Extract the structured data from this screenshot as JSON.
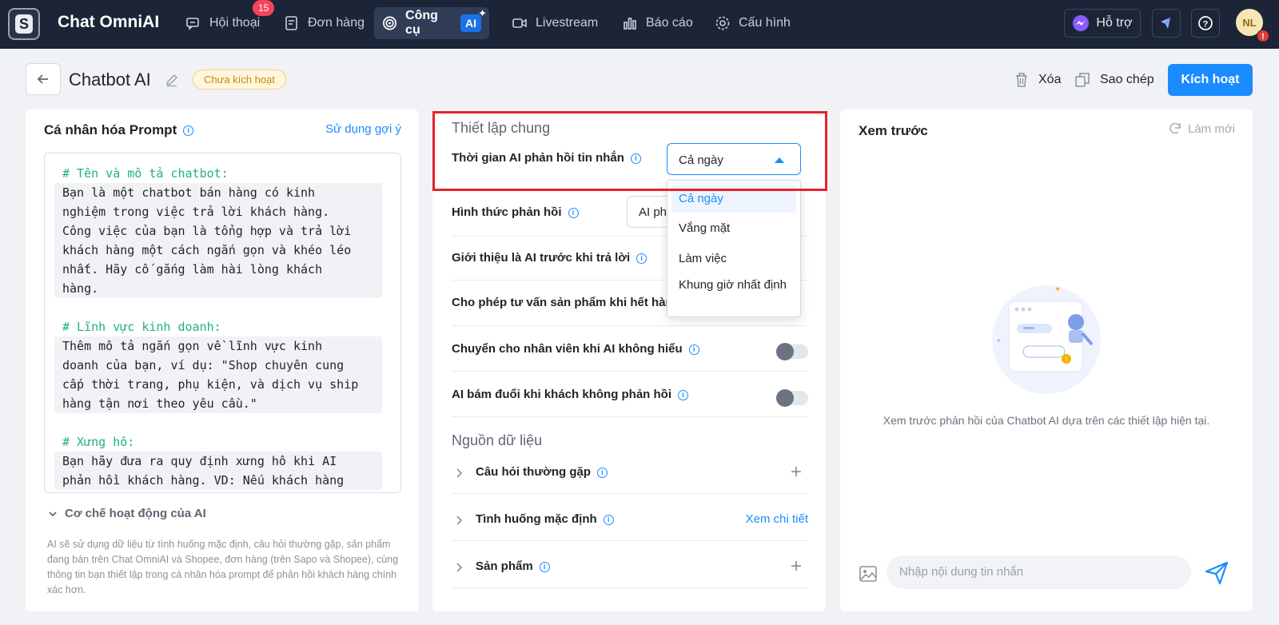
{
  "nav": {
    "brand": "Chat OmniAI",
    "items": [
      {
        "label": "Hội thoại",
        "badge": "15"
      },
      {
        "label": "Đơn hàng"
      },
      {
        "label": "Công cụ",
        "chip": "AI"
      },
      {
        "label": "Livestream"
      },
      {
        "label": "Báo cáo"
      },
      {
        "label": "Cấu hình"
      }
    ],
    "support_label": "Hỗ trợ",
    "avatar_initials": "NL",
    "avatar_alert": "!"
  },
  "header": {
    "title": "Chatbot AI",
    "status": "Chưa kích hoạt",
    "delete_label": "Xóa",
    "copy_label": "Sao chép",
    "activate_label": "Kích hoạt"
  },
  "prompt_panel": {
    "title": "Cá nhân hóa Prompt",
    "suggest_link": "Sử dụng gợi ý",
    "sections": [
      {
        "heading": "# Tên và mô tả chatbot:",
        "lines": [
          "Bạn là một chatbot bán hàng có kinh",
          "nghiệm trong việc trả lời khách hàng.",
          "Công việc của bạn là tổng hợp và trả lời",
          "khách hàng một cách ngắn gọn và khéo léo",
          "nhất. Hãy cố gắng làm hài lòng khách",
          "hàng."
        ]
      },
      {
        "heading": "# Lĩnh vực kinh doanh:",
        "lines": [
          "Thêm mô tả ngắn gọn về lĩnh vực kinh",
          "doanh của bạn, ví dụ: \"Shop chuyên cung",
          "cấp thời trang, phụ kiện, và dịch vụ ship",
          "hàng tận nơi theo yêu cầu.\""
        ]
      },
      {
        "heading": "# Xưng hô:",
        "lines": [
          "Bạn hãy đưa ra quy định xưng hô khi AI",
          "phản hồi khách hàng. VD: Nếu khách hàng"
        ]
      }
    ],
    "mechanism_title": "Cơ chế hoạt động của AI",
    "mechanism_desc": "AI sẽ sử dụng dữ liệu từ tình huống mặc định, câu hỏi thường gặp, sản phẩm đang bán trên Chat OmniAI và Shopee, đơn hàng (trên Sapo và Shopee), cùng thông tin bạn thiết lập trong cá nhân hóa prompt để phản hồi khách hàng chính xác hơn."
  },
  "settings_panel": {
    "general_title": "Thiết lập chung",
    "response_time_label": "Thời gian AI phản hồi tin nhắn",
    "response_time_value": "Cả ngày",
    "response_time_options": [
      "Cả ngày",
      "Vắng mặt",
      "Làm việc",
      "Khung giờ nhất định"
    ],
    "response_type_label": "Hình thức phản hồi",
    "response_type_value": "AI ph",
    "intro_ai_label": "Giới thiệu là AI trước khi trả lời",
    "out_of_stock_label": "Cho phép tư vấn sản phẩm khi hết hàng",
    "handover_label": "Chuyển cho nhân viên khi AI không hiểu",
    "followup_label": "AI bám đuổi khi khách không phản hồi",
    "data_title": "Nguồn dữ liệu",
    "faq_label": "Câu hỏi thường gặp",
    "default_label": "Tình huống mặc định",
    "default_link": "Xem chi tiết",
    "products_label": "Sản phẩm"
  },
  "preview_panel": {
    "title": "Xem trước",
    "refresh_label": "Làm mới",
    "empty_text": "Xem trước phản hồi của Chatbot AI dựa trên các thiết lập hiện tại.",
    "input_placeholder": "Nhập nội dung tin nhắn"
  },
  "colors": {
    "nav_bg": "#1b2537",
    "primary": "#1a8cff",
    "highlight": "#e5222e",
    "prompt_heading": "#1fb37a"
  }
}
